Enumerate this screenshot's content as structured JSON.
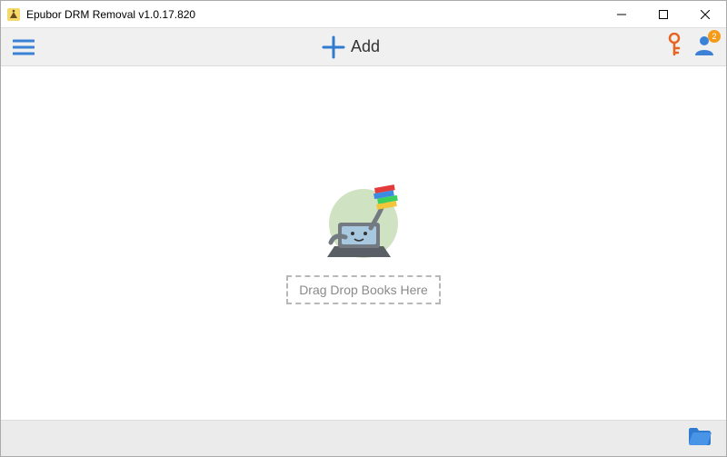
{
  "window": {
    "title": "Epubor DRM Removal v1.0.17.820"
  },
  "toolbar": {
    "add_label": "Add",
    "user_badge": "2"
  },
  "main": {
    "drop_hint": "Drag Drop Books Here"
  },
  "icons": {
    "app": "app-icon",
    "minimize": "minimize-icon",
    "maximize": "maximize-icon",
    "close": "close-icon",
    "hamburger": "hamburger-icon",
    "plus": "plus-icon",
    "key": "key-icon",
    "user": "user-icon",
    "folder": "folder-icon"
  }
}
